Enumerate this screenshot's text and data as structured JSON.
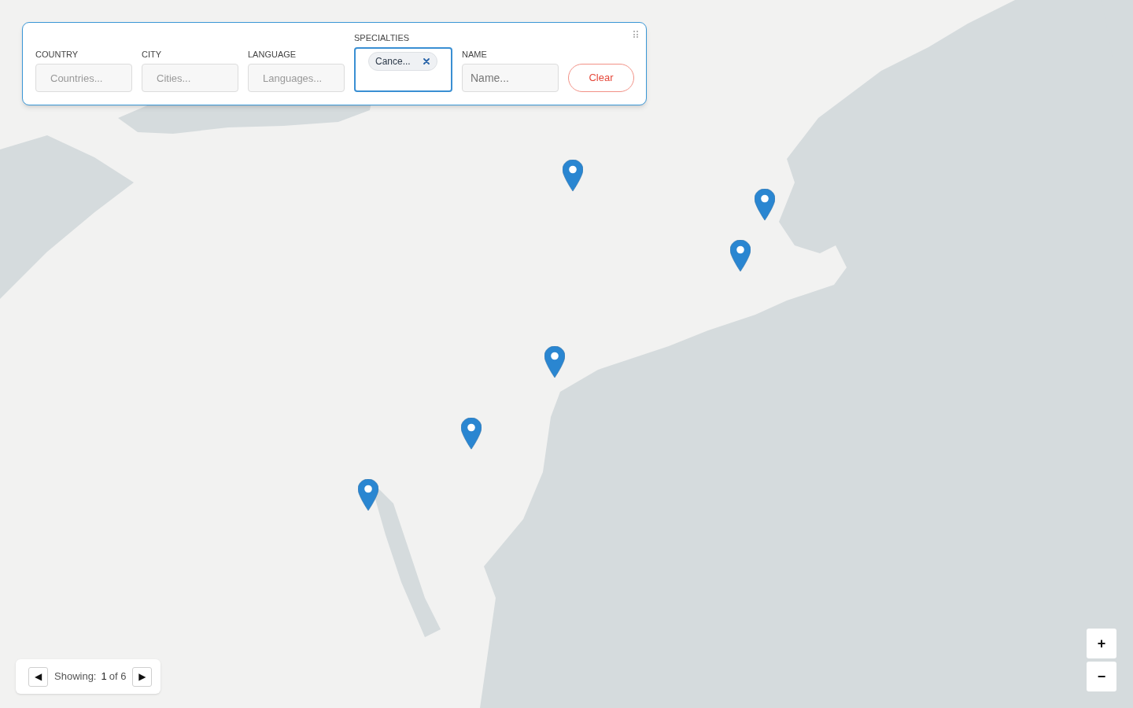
{
  "filters": [
    {
      "kind": "input",
      "label": "COUNTRY",
      "placeholder": "Countries..."
    },
    {
      "kind": "input",
      "label": "CITY",
      "placeholder": "Cities..."
    },
    {
      "kind": "input",
      "label": "LANGUAGE",
      "placeholder": "Languages..."
    },
    {
      "kind": "tags",
      "label": "SPECIALTIES",
      "focused": true,
      "tags": [
        {
          "text": "Cance..."
        }
      ]
    },
    {
      "kind": "name",
      "label": "NAME",
      "placeholder": "Name..."
    }
  ],
  "clear_button": "Clear",
  "pager": {
    "previous": "◀",
    "label": "Showing:",
    "current": "1",
    "total": "of 6",
    "next": "▶"
  },
  "zoom": {
    "zoom_in": "+",
    "zoom_out": "−"
  }
}
